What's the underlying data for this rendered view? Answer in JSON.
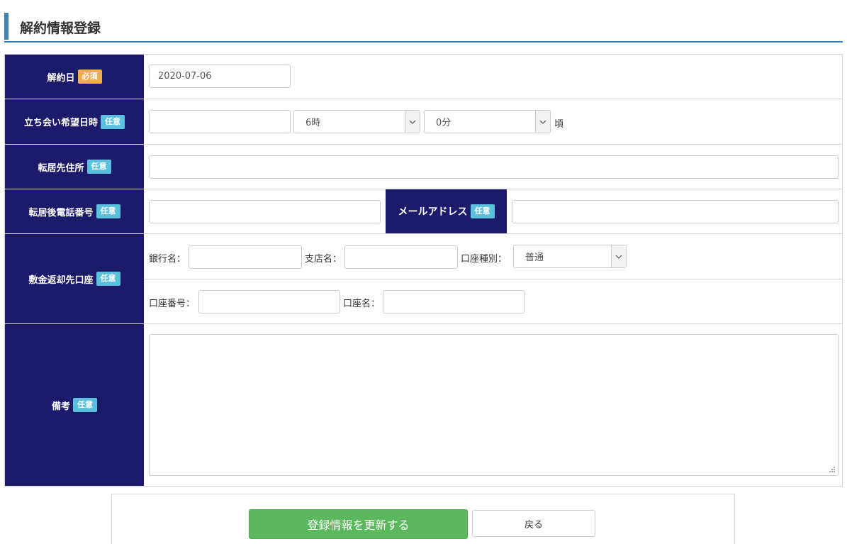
{
  "header": {
    "title": "解約情報登録"
  },
  "badges": {
    "required": "必須",
    "optional": "任意"
  },
  "form": {
    "cancel_date": {
      "label": "解約日",
      "value": "2020-07-06"
    },
    "visit": {
      "label": "立ち会い希望日時",
      "date_value": "",
      "hour_selected": "6時",
      "minute_selected": "0分",
      "suffix": "頃"
    },
    "new_address": {
      "label": "転居先住所",
      "value": ""
    },
    "new_phone": {
      "label": "転居後電話番号",
      "value": ""
    },
    "email": {
      "label": "メールアドレス",
      "value": ""
    },
    "refund_account": {
      "label": "敷金返却先口座",
      "bank_label": "銀行名：",
      "branch_label": "支店名：",
      "type_label": "口座種別：",
      "type_selected": "普通",
      "number_label": "口座番号：",
      "holder_label": "口座名："
    },
    "remarks": {
      "label": "備考",
      "value": ""
    }
  },
  "actions": {
    "submit_label": "登録情報を更新する",
    "back_label": "戻る"
  },
  "colors": {
    "header_accent": "#3b82b8",
    "label_bg": "#1b1a6b",
    "required_badge": "#f0ad4e",
    "optional_badge": "#5bc0de",
    "submit_button": "#5cb85c"
  }
}
